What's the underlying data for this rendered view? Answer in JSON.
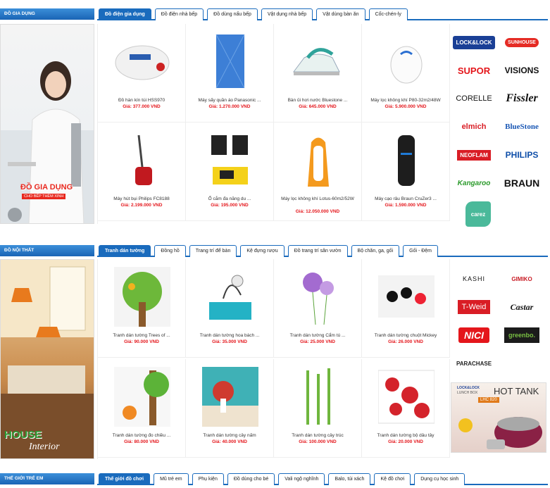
{
  "section1": {
    "title": "ĐỒ GIA DỤNG",
    "tabs": [
      "Đồ điện gia dụng",
      "Đồ điện nhà bếp",
      "Đồ dùng nấu bếp",
      "Vật dụng nhà bếp",
      "Vật dùng bàn ăn",
      "Cốc-chén-ly"
    ],
    "banner": {
      "title": "ĐỒ GIA DỤNG",
      "subtitle": "CHO BẾP THÊM XINH"
    },
    "products": [
      {
        "name": "Đồ hàn kín túi HSS970",
        "price": "Giá: 377.000 VND"
      },
      {
        "name": "Máy sấy quần áo Panasonic ...",
        "price": "Giá: 1.270.000 VND"
      },
      {
        "name": "Bàn ủi hơi nước Bluestone ...",
        "price": "Giá: 645.000 VND"
      },
      {
        "name": "Máy lọc không khí P80-32m2/48W",
        "price": "Giá: 5.900.000 VND"
      },
      {
        "name": "Máy hút bụi Philips FC8188",
        "price": "Giá: 2.199.000 VND"
      },
      {
        "name": "Ổ cắm đa năng du ...",
        "price": "Giá: 195.000 VND"
      },
      {
        "name": "Máy lọc không khí Lotus-60m2/52W",
        "price": "Giá: 12.050.000 VND"
      },
      {
        "name": "Máy cạo râu Braun CruZer3 ...",
        "price": "Giá: 1.590.000 VND"
      }
    ],
    "brands": [
      "LOCK&LOCK",
      "SUNHOUSE",
      "SUPOR",
      "VISIONS",
      "CORELLE",
      "Fissler",
      "elmich",
      "BlueStone",
      "NEOFLAM",
      "PHILIPS",
      "Kangaroo",
      "BRAUN",
      "carez"
    ]
  },
  "section2": {
    "title": "ĐỒ NỘI THẤT",
    "tabs": [
      "Tranh dán tường",
      "Đồng hồ",
      "Trang trí để bàn",
      "Kệ đựng rượu",
      "Đồ trang trí sân vườn",
      "Bộ chăn, ga, gối",
      "Gối - Đệm"
    ],
    "banner": {
      "title": "HOUSE",
      "subtitle": "Interior"
    },
    "products": [
      {
        "name": "Tranh dán tường Trees of ...",
        "price": "Giá: 90.000 VND"
      },
      {
        "name": "Tranh dán tường hoa bách ...",
        "price": "Giá: 35.000 VND"
      },
      {
        "name": "Tranh dán tường Cẩm tú ...",
        "price": "Giá: 25.000 VND"
      },
      {
        "name": "Tranh dán tường chuột Mickey",
        "price": "Giá: 26.000 VND"
      },
      {
        "name": "Tranh dán tường đo chiều ...",
        "price": "Giá: 80.000 VND"
      },
      {
        "name": "Tranh dán tường cây nấm",
        "price": "Giá: 40.000 VND"
      },
      {
        "name": "Tranh dán tường cây trúc",
        "price": "Giá: 100.000 VND"
      },
      {
        "name": "Tranh dán tường bộ dâu tây",
        "price": "Giá: 20.000 VND"
      }
    ],
    "brands": [
      "KASHI",
      "GIMIKO",
      "T-Weid",
      "Castar",
      "NICI",
      "greenbo.",
      "PARACHASE"
    ],
    "ad": {
      "brand": "LOCK&LOCK",
      "line": "LUNCH BOX",
      "title": "HOT TANK",
      "model": "LHC 820"
    }
  },
  "section3": {
    "title": "THẾ GIỚI TRẺ EM",
    "tabs": [
      "Thế giới đồ chơi",
      "Mũ trẻ em",
      "Phụ kiện",
      "Đồ dùng cho bé",
      "Vali ngộ nghĩnh",
      "Balo, túi xách",
      "Kệ đồ chơi",
      "Dụng cụ học sinh"
    ]
  },
  "colors": {
    "accent": "#1a6bbd",
    "price": "#e4161b"
  }
}
